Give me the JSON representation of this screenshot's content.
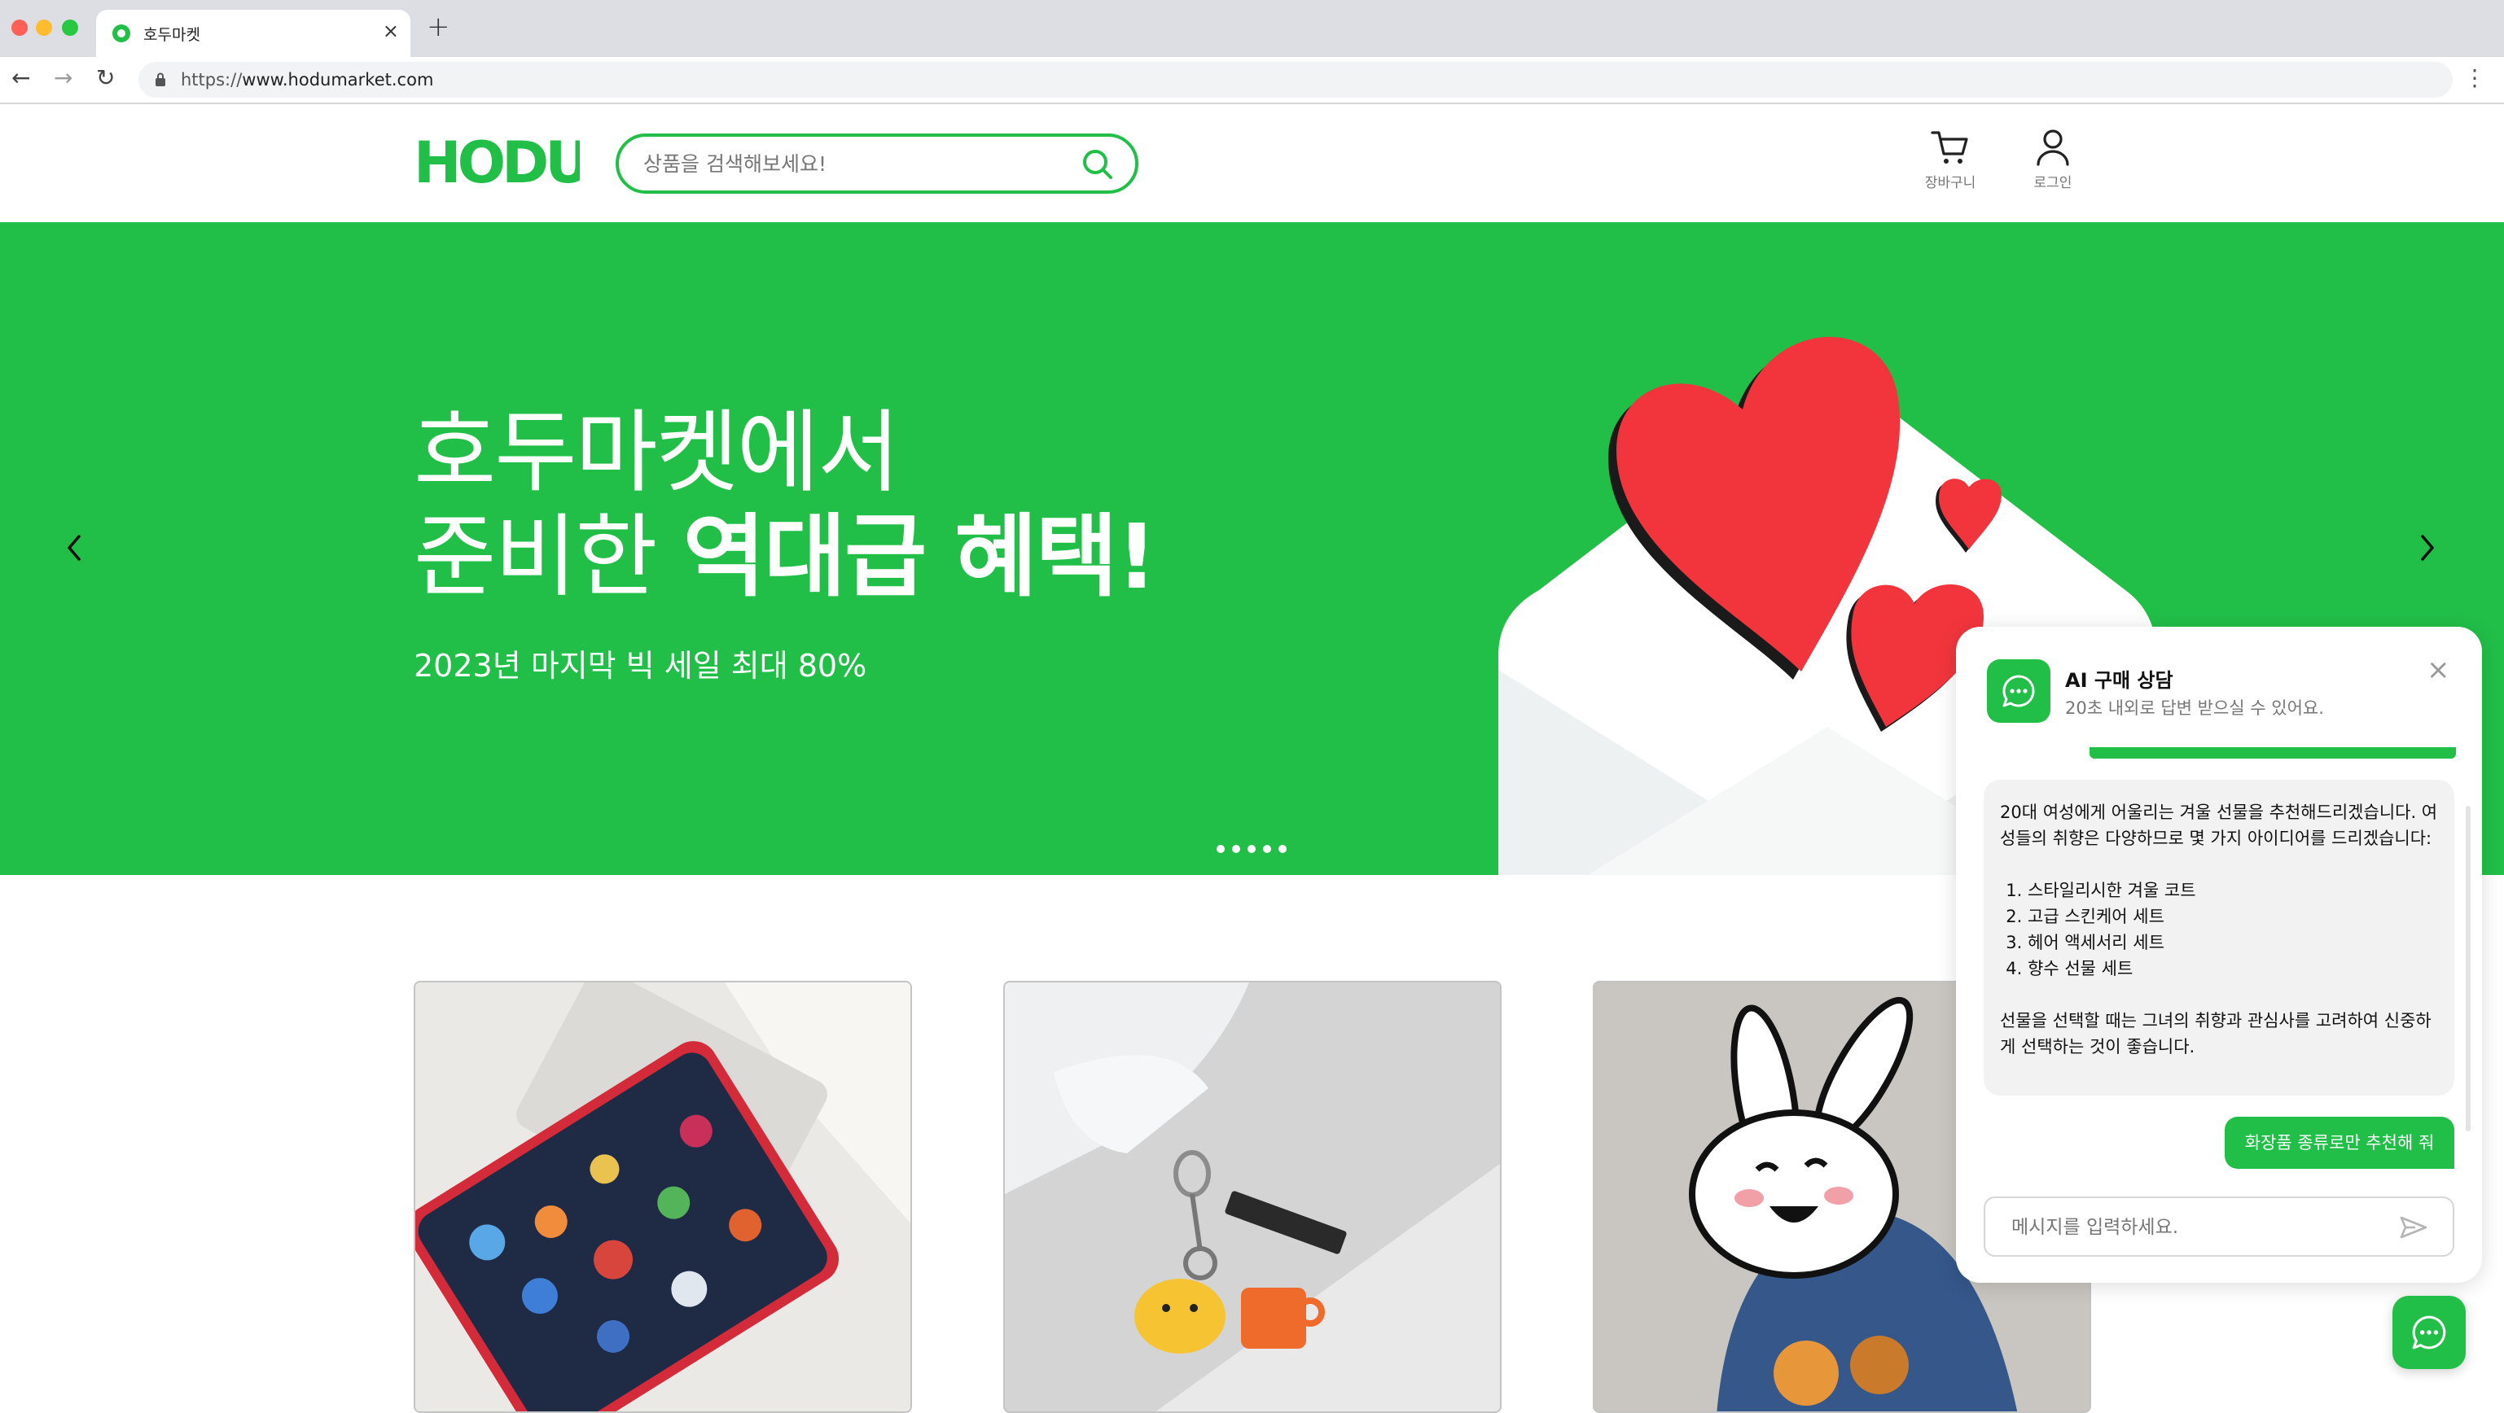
{
  "browser": {
    "tab_title": "호두마켓",
    "tab_close": "×",
    "new_tab": "+",
    "url_scheme": "https://",
    "url_host": "www.hodumarket.com",
    "back": "←",
    "forward": "→",
    "reload": "↻",
    "menu": "⋮"
  },
  "header": {
    "logo_text": "HODU",
    "search_placeholder": "상품을 검색해보세요!",
    "cart_label": "장바구니",
    "login_label": "로그인"
  },
  "banner": {
    "line1": "호두마켓에서",
    "line2_normal": "준비한 ",
    "line2_bold": "역대급 혜택!",
    "subtitle": "2023년 마지막 빅 세일 최대 80%",
    "slide_count": 5,
    "active_slide": 1
  },
  "products": [
    {
      "image": "laptop pouch with developer stickers"
    },
    {
      "image": "keyring with cat and mug charms"
    },
    {
      "image": "white rabbit character on denim"
    }
  ],
  "chat": {
    "title": "AI 구매 상담",
    "subtitle": "20초 내외로 답변 받으실 수 있어요.",
    "close": "×",
    "bot_intro": "20대 여성에게 어울리는 겨울 선물을 추천해드리겠습니다. 여성들의 취향은 다양하므로 몇 가지 아이디어를 드리겠습니다:",
    "bot_list": [
      "스타일리시한 겨울 코트",
      "고급 스킨케어 세트",
      "헤어 액세서리 세트",
      "향수 선물 세트"
    ],
    "bot_outro": "선물을 선택할 때는 그녀의 취향과 관심사를 고려하여 신중하게 선택하는 것이 좋습니다.",
    "user_message": "화장품 종류로만 추천해 줘",
    "input_placeholder": "메시지를 입력하세요."
  },
  "colors": {
    "brand": "#21bf48",
    "heart": "#f2353d",
    "text_muted": "#767676"
  },
  "icons": [
    "lock-icon",
    "search-icon",
    "cart-icon",
    "user-icon",
    "chevron-left-icon",
    "chevron-right-icon",
    "chat-bubble-icon",
    "close-icon",
    "send-icon"
  ]
}
